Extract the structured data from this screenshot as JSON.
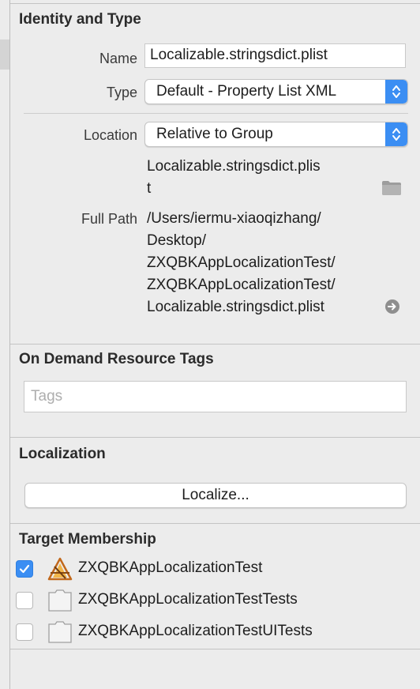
{
  "identity": {
    "title": "Identity and Type",
    "name_label": "Name",
    "name_value": "Localizable.stringsdict.plist",
    "type_label": "Type",
    "type_value": "Default - Property List XML",
    "location_label": "Location",
    "location_value": "Relative to Group",
    "relative_path_line1": "Localizable.stringsdict.plis",
    "relative_path_line2": "t",
    "full_path_label": "Full Path",
    "full_path_lines": [
      "/Users/iermu-xiaoqizhang/",
      "Desktop/",
      "ZXQBKAppLocalizationTest/",
      "ZXQBKAppLocalizationTest/",
      "Localizable.stringsdict.plist"
    ]
  },
  "on_demand": {
    "title": "On Demand Resource Tags",
    "tags_placeholder": "Tags"
  },
  "localization": {
    "title": "Localization",
    "button_label": "Localize..."
  },
  "target_membership": {
    "title": "Target Membership",
    "targets": [
      {
        "label": "ZXQBKAppLocalizationTest",
        "checked": true,
        "icon": "app-icon"
      },
      {
        "label": "ZXQBKAppLocalizationTestTests",
        "checked": false,
        "icon": "test-bundle-icon"
      },
      {
        "label": "ZXQBKAppLocalizationTestUITests",
        "checked": false,
        "icon": "test-bundle-icon"
      }
    ]
  },
  "colors": {
    "accent": "#3b8ef3",
    "background": "#ececec"
  }
}
